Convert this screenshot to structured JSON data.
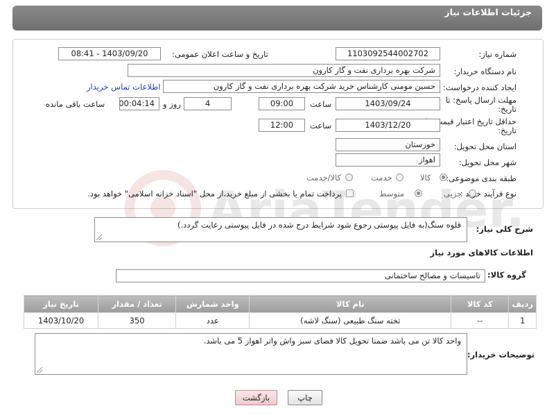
{
  "header": {
    "title": "جزئیات اطلاعات نیاز"
  },
  "form": {
    "need_number_label": "شماره نیاز:",
    "need_number": "1103092544002702",
    "announce_label": "تاریخ و ساعت اعلان عمومی:",
    "announce_value": "1403/09/20 - 08:41",
    "buyer_org_label": "نام دستگاه خریدار:",
    "buyer_org": "شرکت بهره برداری نفت و گاز کارون",
    "creator_label": "ایجاد کننده درخواست:",
    "creator": "حسین مومنی کارشناس خرید شرکت بهره برداری نفت و گاز کارون",
    "contact_link": "اطلاعات تماس خریدار",
    "deadline_label_1": "مهلت ارسال پاسخ: تا",
    "deadline_label_2": "تاریخ:",
    "deadline_date": "1403/09/24",
    "time_label": "ساعت",
    "deadline_time": "09:00",
    "days_value": "4",
    "days_label": "روز و",
    "remaining_value": "00:04:14",
    "remaining_label": "ساعت باقی مانده",
    "validity_label_1": "حداقل تاریخ اعتبار قیمت: تا",
    "validity_label_2": "تاریخ:",
    "validity_date": "1403/12/20",
    "validity_time": "12:00",
    "province_label": "استان محل تحویل:",
    "province": "خوزستان",
    "city_label": "شهر محل تحویل:",
    "city": "اهواز",
    "category_label": "طبقه بندی موضوعی:",
    "category_options": [
      "کالا",
      "خدمت",
      "کالا/خدمت"
    ],
    "category_selected": "کالا",
    "process_label": "نوع فرآیند خرید :",
    "process_options": [
      "جزیی",
      "متوسط"
    ],
    "process_selected": "متوسط",
    "payment_note": "پرداخت تمام یا بخشی از مبلغ خرید،از محل \"اسناد خزانه اسلامی\" خواهد بود."
  },
  "description": {
    "label": "شرح کلی نیاز:",
    "value": "قلوه سنگ(به فایل پیوستی رجوع شود شرایط درج شده در فایل پیوستی رعایت گردد.)"
  },
  "goods": {
    "section_title": "اطلاعات کالاهای مورد نیاز",
    "group_label": "گروه کالا:",
    "group_value": "تاسیسات و مصالح ساختمانی",
    "columns": [
      "ردیف",
      "کد کالا",
      "نام کالا",
      "واحد شمارش",
      "تعداد / مقدار",
      "تاریخ نیاز"
    ],
    "rows": [
      {
        "row": "1",
        "code": "--",
        "name": "تخته سنگ طبیعی (سنگ لاشه)",
        "unit": "عدد",
        "qty": "350",
        "date": "1403/10/20"
      }
    ]
  },
  "buyer_notes": {
    "label": "توضیحات خریدار:",
    "value": "واحد کالا تن می باشد ضمنا تحویل کالا فضای سبز واش واتر اهواز 5  می باشد."
  },
  "buttons": {
    "print": "چاپ",
    "back": "بازگشت"
  },
  "watermark": {
    "text": "AriaTender.neT"
  }
}
